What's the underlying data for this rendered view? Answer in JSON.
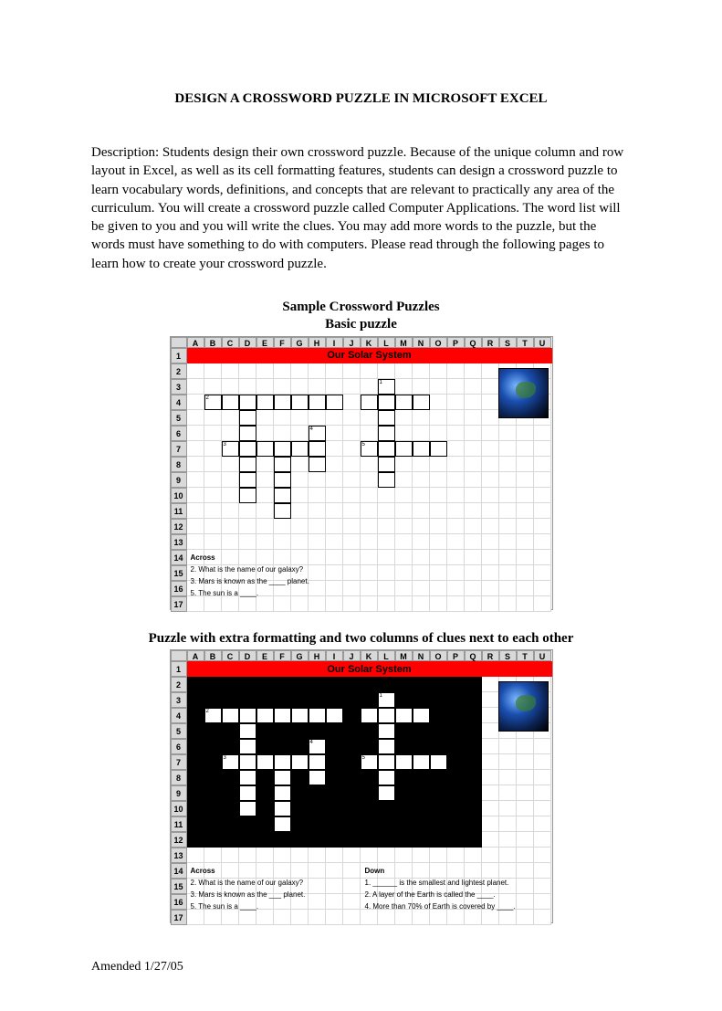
{
  "title": "DESIGN A CROSSWORD PUZZLE IN MICROSOFT EXCEL",
  "description": "Description: Students design their own crossword puzzle. Because of the unique column and row layout in Excel, as well as its cell formatting features, students can design a crossword puzzle to learn vocabulary words, definitions, and concepts that are relevant to practically any area of the curriculum.  You will create a crossword puzzle called Computer Applications.  The word list will be given to you and you will write the clues.  You may add more words to the puzzle, but the words must have something to do with computers.  Please read through the following pages to learn how to create your crossword puzzle.",
  "subhead1a": "Sample Crossword Puzzles",
  "subhead1b": "Basic puzzle",
  "subhead2": "Puzzle with extra formatting and two columns of clues next to each other",
  "columns": [
    "A",
    "B",
    "C",
    "D",
    "E",
    "F",
    "G",
    "H",
    "I",
    "J",
    "K",
    "L",
    "M",
    "N",
    "O",
    "P",
    "Q",
    "R",
    "S",
    "T",
    "U"
  ],
  "rows": [
    1,
    2,
    3,
    4,
    5,
    6,
    7,
    8,
    9,
    10,
    11,
    12,
    13,
    14,
    15,
    16,
    17
  ],
  "banner_title": "Our Solar System",
  "earth_name": "earth-image",
  "fig1": {
    "across_head": "Across",
    "clues": [
      "2. What is the name of our galaxy?",
      "3. Mars is known as the ____ planet.",
      "5. The sun is a ____."
    ]
  },
  "fig2": {
    "across_head": "Across",
    "down_head": "Down",
    "across": [
      "2. What is the name of our galaxy?",
      "3. Mars is known as the ___ planet.",
      "5. The sun is a ____."
    ],
    "down": [
      "1. ______ is the smallest and lightest planet.",
      "2. A layer of the Earth is called the ____.",
      "4. More than 70% of Earth is covered by ____."
    ]
  },
  "footer": "Amended 1/27/05"
}
